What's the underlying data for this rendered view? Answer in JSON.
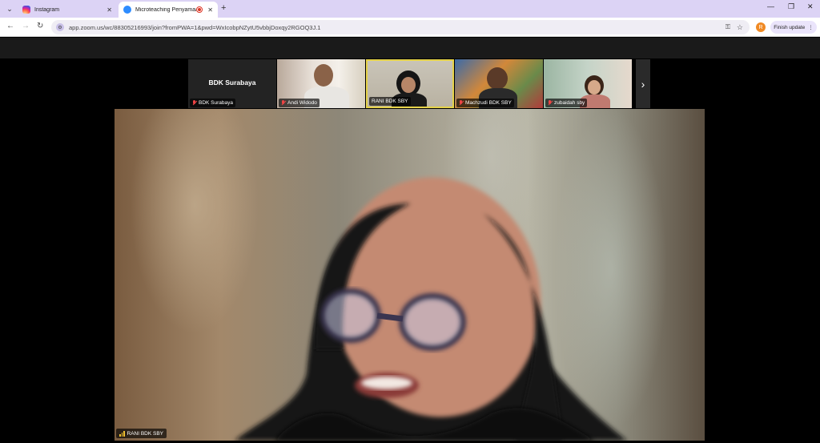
{
  "browser": {
    "tabs": [
      {
        "title": "Instagram",
        "active": false,
        "icon": "instagram-icon"
      },
      {
        "title": "Microteaching Penyamaan",
        "active": true,
        "icon": "zoom-icon",
        "recording": true
      }
    ],
    "url": "app.zoom.us/wc/88305216993/join?fromPWA=1&pwd=WxIcobpNZytU5vbbjDoxqy2RGOQ3J.1",
    "profile_initial": "R",
    "update_label": "Finish update",
    "colors": {
      "tab_strip": "#dcd3f5",
      "profile": "#f08a24"
    }
  },
  "zoom": {
    "gallery": [
      {
        "name": "BDK Surabaya",
        "display_name": "BDK Surabaya",
        "muted": true,
        "video": false
      },
      {
        "name": "Andi Widodo",
        "muted": true,
        "video": true
      },
      {
        "name": "RANI BDK SBY",
        "muted": false,
        "video": true,
        "active_speaker": true
      },
      {
        "name": "Machzudi BDK SBY",
        "muted": true,
        "video": true
      },
      {
        "name": "zubaidah sby",
        "muted": true,
        "video": true
      }
    ],
    "main_speaker": {
      "name": "RANI BDK SBY",
      "audio_icon": "audio-level-icon"
    },
    "colors": {
      "active_border": "#e6d34a",
      "muted": "#e44444"
    }
  }
}
